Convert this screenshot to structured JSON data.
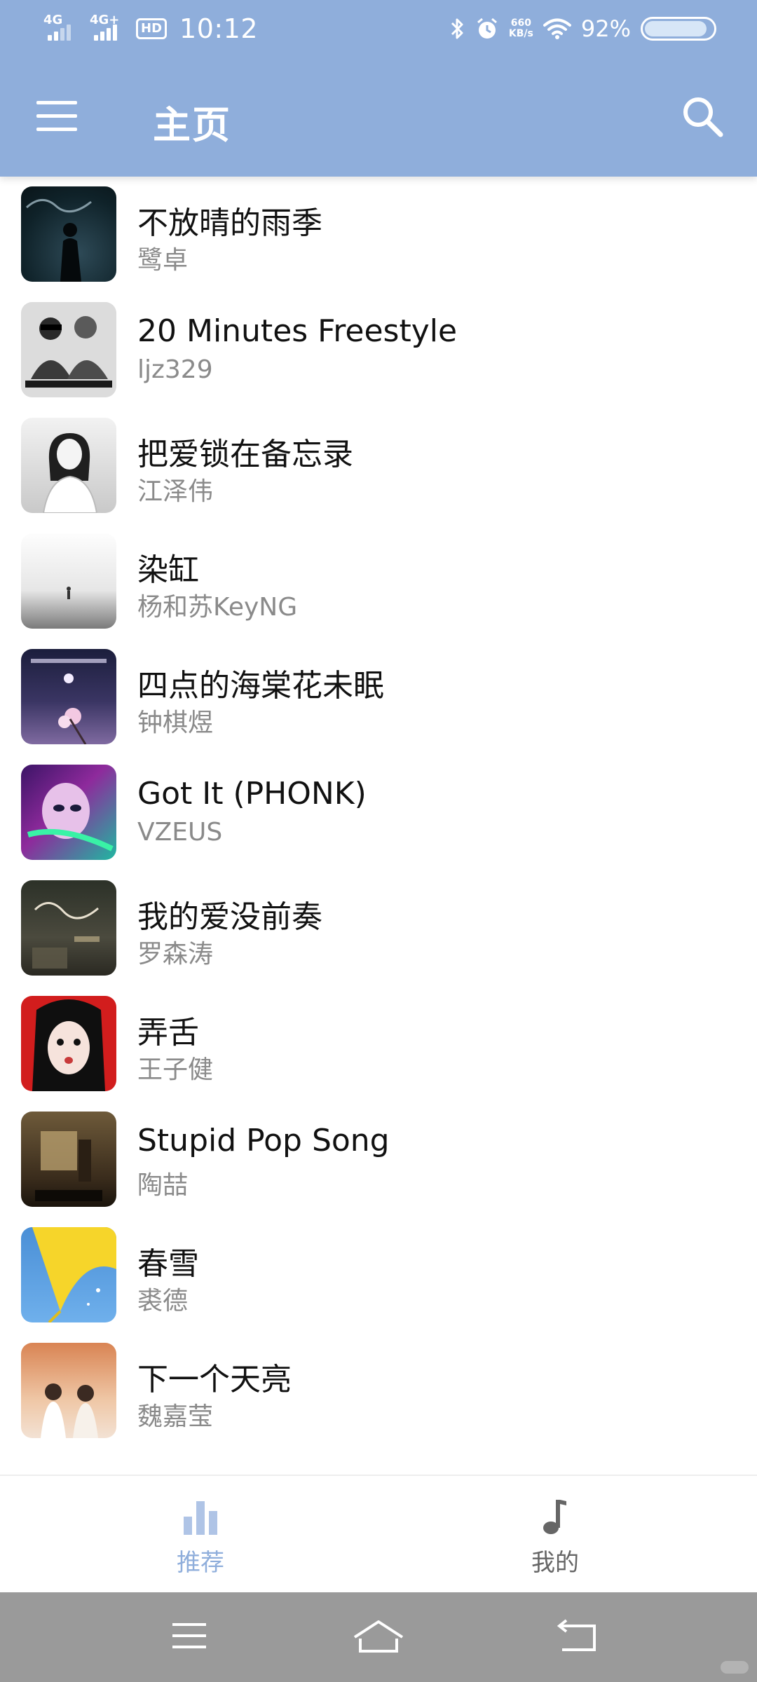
{
  "status_bar": {
    "network1": "4G",
    "network2": "4G+",
    "hd_label": "HD",
    "time": "10:12",
    "speed_value": "660",
    "speed_unit": "KB/s",
    "battery_text": "92%",
    "battery_level": 0.92,
    "icons": [
      "bluetooth-icon",
      "alarm-icon",
      "wifi-icon",
      "battery-icon"
    ]
  },
  "app_bar": {
    "title": "主页",
    "left_icon": "menu-icon",
    "right_icon": "search-icon",
    "background_color": "#8FAEDB"
  },
  "songs": [
    {
      "title": "不放晴的雨季",
      "artist": "鹭卓"
    },
    {
      "title": "20 Minutes Freestyle",
      "artist": "ljz329"
    },
    {
      "title": "把爱锁在备忘录",
      "artist": "江泽伟"
    },
    {
      "title": "染缸",
      "artist": "杨和苏KeyNG"
    },
    {
      "title": "四点的海棠花未眠",
      "artist": "钟棋煜"
    },
    {
      "title": "Got It (PHONK)",
      "artist": "VZEUS"
    },
    {
      "title": "我的爱没前奏",
      "artist": "罗森涛"
    },
    {
      "title": "弄舌",
      "artist": "王子健"
    },
    {
      "title": "Stupid Pop Song",
      "artist": "陶喆"
    },
    {
      "title": "春雪",
      "artist": "裘德"
    },
    {
      "title": "下一个天亮",
      "artist": "魏嘉莹"
    }
  ],
  "bottom_nav": {
    "items": [
      {
        "label": "推荐",
        "icon": "bar-chart-icon",
        "active": true
      },
      {
        "label": "我的",
        "icon": "music-note-icon",
        "active": false
      }
    ],
    "active_color": "#8FAEDB",
    "inactive_color": "#666666"
  },
  "system_nav": {
    "icons": [
      "recents-icon",
      "home-icon",
      "back-icon"
    ]
  }
}
